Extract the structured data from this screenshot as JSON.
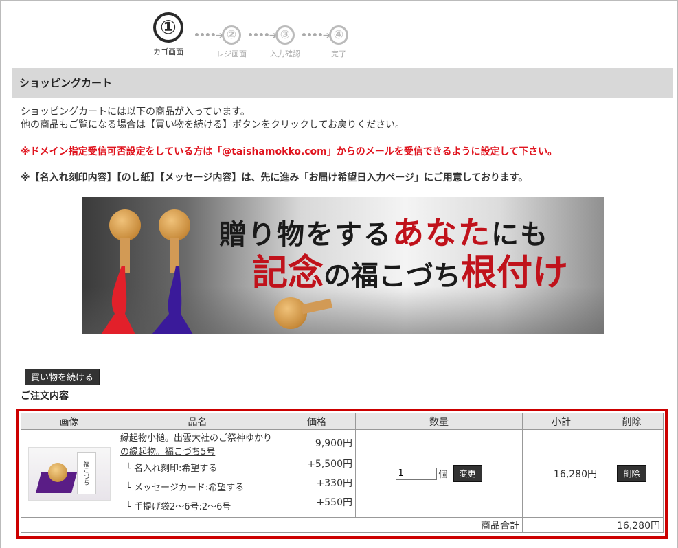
{
  "steps": [
    {
      "number": "①",
      "label": "カゴ画面"
    },
    {
      "number": "②",
      "label": "レジ画面"
    },
    {
      "number": "③",
      "label": "入力確認"
    },
    {
      "number": "④",
      "label": "完了"
    }
  ],
  "step_arrow": "••••➔",
  "cart": {
    "title": "ショッピングカート",
    "intro_line1": "ショッピングカートには以下の商品が入っています。",
    "intro_line2": "他の商品もご覧になる場合は【買い物を続ける】ボタンをクリックしてお戻りください。",
    "warning": "※ドメイン指定受信可否設定をしている方は「@taishamokko.com」からのメールを受信できるように設定して下さい。",
    "note": "※【名入れ刻印内容】【のし紙】【メッセージ内容】は、先に進み「お届け希望日入力ページ」にご用意しております。"
  },
  "banner": {
    "line1_a": "贈り物をする",
    "line1_b": "あなた",
    "line1_c": "にも",
    "line2_a": "記念",
    "line2_b": "の福こづち",
    "line2_c": "根付け",
    "thumb_tag": "福こづち"
  },
  "continue_button": "買い物を続ける",
  "order": {
    "title": "ご注文内容",
    "headers": {
      "image": "画像",
      "name": "品名",
      "price": "価格",
      "qty": "数量",
      "subtotal": "小計",
      "delete": "削除"
    },
    "item": {
      "name": "縁起物小槌。出雲大社のご祭神ゆかりの縁起物。福こづち5号",
      "price": "9,900円",
      "options": [
        {
          "label": "└ 名入れ刻印:希望する",
          "price": "+5,500円"
        },
        {
          "label": "└ メッセージカード:希望する",
          "price": "+330円"
        },
        {
          "label": "└ 手提げ袋2～6号:2～6号",
          "price": "+550円"
        }
      ],
      "qty": "1",
      "qty_unit": "個",
      "change_button": "変更",
      "subtotal": "16,280円",
      "delete_button": "削除"
    },
    "total_label": "商品合計",
    "total_value": "16,280円"
  },
  "colors": {
    "accent_red": "#e0141e",
    "box_border": "#cc0000",
    "header_bg": "#d8d8d8"
  }
}
